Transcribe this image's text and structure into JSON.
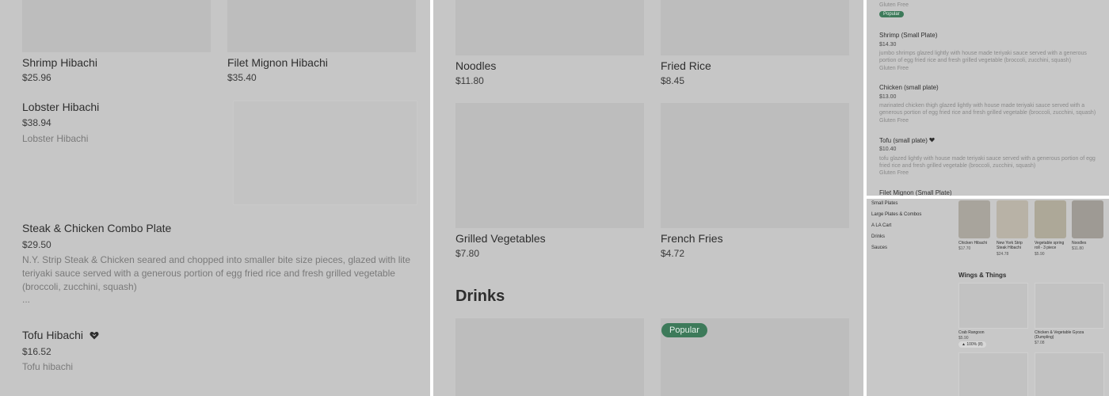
{
  "panel1": {
    "shrimp_hibachi": {
      "name": "Shrimp Hibachi",
      "price": "$25.96"
    },
    "filet_mignon_hibachi": {
      "name": "Filet Mignon Hibachi",
      "price": "$35.40"
    },
    "lobster_hibachi": {
      "name": "Lobster Hibachi",
      "price": "$38.94",
      "desc": "Lobster Hibachi"
    },
    "steak_chicken_combo": {
      "name": "Steak & Chicken Combo Plate",
      "price": "$29.50",
      "desc": "N.Y. Strip Steak & Chicken seared and chopped into smaller bite size pieces, glazed with lite teriyaki sauce served with a generous portion of egg fried rice and fresh grilled vegetable (broccoli, zucchini, squash)",
      "more": "..."
    },
    "tofu_hibachi": {
      "name": "Tofu Hibachi",
      "price": "$16.52",
      "desc": "Tofu hibachi"
    }
  },
  "panel2": {
    "noodles": {
      "name": "Noodles",
      "price": "$11.80"
    },
    "fried_rice": {
      "name": "Fried Rice",
      "price": "$8.45"
    },
    "grilled_vegetables": {
      "name": "Grilled Vegetables",
      "price": "$7.80"
    },
    "french_fries": {
      "name": "French Fries",
      "price": "$4.72"
    },
    "drinks_title": "Drinks",
    "popular_badge": "Popular"
  },
  "panel3": {
    "top_tag": "Gluten Free",
    "popular_badge": "Popular",
    "items": [
      {
        "name": "Shrimp (Small Plate)",
        "price": "$14.30",
        "desc": "jumbo shrimps glazed lightly with house made teriyaki sauce served with a generous portion of egg fried rice and fresh grilled vegetable (broccoli, zucchini, squash)",
        "tag": "Gluten Free"
      },
      {
        "name": "Chicken (small plate)",
        "price": "$13.00",
        "desc": "marinated chicken thigh glazed lightly with house made teriyaki sauce served with a generous portion of egg fried rice and fresh grilled vegetable (broccoli, zucchini, squash)",
        "tag": "Gluten Free"
      },
      {
        "name": "Tofu (small plate)",
        "price": "$10.40",
        "desc": "tofu glazed lightly with house made teriyaki sauce served with a generous portion of egg fried rice and fresh grilled vegetable (broccoli, zucchini, squash)",
        "tag": "Gluten Free"
      }
    ],
    "last_item_name": "Filet Mignon (Small Plate)"
  },
  "panel4": {
    "nav": [
      "Small Plates",
      "Large Plates & Combos",
      "A LA Cart",
      "Drinks",
      "Sauces"
    ],
    "thumbs": [
      {
        "label": "Chicken Hibachi",
        "price": "$17.70"
      },
      {
        "label": "New York Strip Steak Hibachi",
        "price": "$24.78"
      },
      {
        "label": "Vegetable spring roll - 3 piece",
        "price": "$5.90"
      },
      {
        "label": "Noodles",
        "price": "$11.80"
      }
    ],
    "section_title": "Wings & Things",
    "tiles": [
      {
        "label": "Crab Rangoon",
        "price": "$5.90",
        "rating": "100% (8)"
      },
      {
        "label": "Chicken & Vegetable Gyoza (Dumpling)",
        "price": "$7.08"
      }
    ]
  },
  "colors": {
    "panel_bg": "#c6c6c6",
    "badge_green": "#3d7a5a",
    "placeholder": "#bdbdbd"
  },
  "icons": {
    "heart": "heart-icon",
    "thumbs_up": "thumbs-up-icon"
  }
}
